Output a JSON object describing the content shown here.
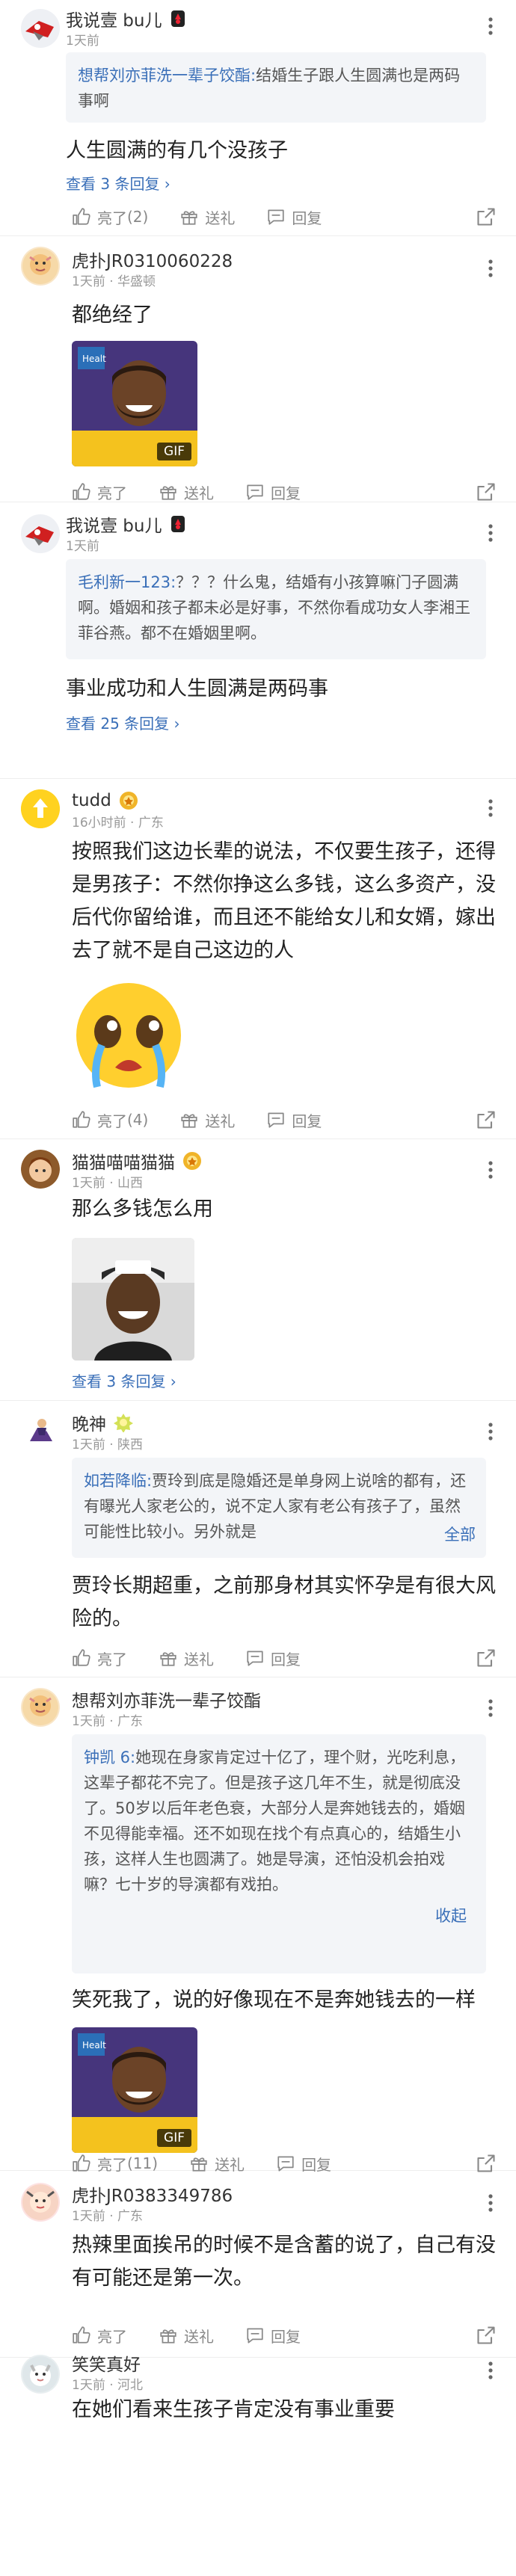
{
  "actions": {
    "like": "亮了",
    "gift": "送礼",
    "reply": "回复"
  },
  "comments": [
    {
      "username": "我说壹 bu儿",
      "meta": "1天前",
      "quote_author": "想帮刘亦菲洗一辈子饺酯:",
      "quote_text": "结婚生子跟人生圆满也是两码事啊",
      "text": "人生圆满的有几个没孩子",
      "replies": "查看 3 条回复",
      "likes": "(2)"
    },
    {
      "username": "虎扑JR0310060228",
      "meta": "1天前 · 华盛顿",
      "text": "都绝经了",
      "gif": "GIF"
    },
    {
      "username": "我说壹 bu儿",
      "meta": "1天前",
      "quote_author": "毛利新一123:",
      "quote_text": "？？？什么鬼，结婚有小孩算嘛门子圆满啊。婚姻和孩子都未必是好事，不然你看成功女人李湘王菲谷燕。都不在婚姻里啊。",
      "text": "事业成功和人生圆满是两码事",
      "replies": "查看 25 条回复"
    },
    {
      "username": "tudd",
      "meta": "16小时前 · 广东",
      "text": "按照我们这边长辈的说法，不仅要生孩子，还得是男孩子：不然你挣这么多钱，这么多资产，没后代你留给谁，而且还不能给女儿和女婿，嫁出去了就不是自己这边的人",
      "likes": "(4)"
    },
    {
      "username": "猫猫喵喵猫猫",
      "meta": "1天前 · 山西",
      "text": "那么多钱怎么用",
      "replies": "查看 3 条回复"
    },
    {
      "username": "晚神",
      "meta": "1天前 · 陕西",
      "quote_author": "如若降临:",
      "quote_text": "贾玲到底是隐婚还是单身网上说啥的都有，还有曝光人家老公的，说不定人家有老公有孩子了，虽然可能性比较小。另外就是",
      "quote_more": "全部",
      "text": "贾玲长期超重，之前那身材其实怀孕是有很大风险的。"
    },
    {
      "username": "想帮刘亦菲洗一辈子饺酯",
      "meta": "1天前 · 广东",
      "quote_author": "钟凯 6:",
      "quote_text": "她现在身家肯定过十亿了，理个财，光吃利息，这辈子都花不完了。但是孩子这几年不生，就是彻底没了。50岁以后年老色衰，大部分人是奔她钱去的，婚姻不见得能幸福。还不如现在找个有点真心的，结婚生小孩，这样人生也圆满了。她是导演，还怕没机会拍戏嘛？七十岁的导演都有戏拍。",
      "quote_collapse": "收起",
      "text": "笑死我了，说的好像现在不是奔她钱去的一样",
      "gif": "GIF",
      "likes": "(11)"
    },
    {
      "username": "虎扑JR0383349786",
      "meta": "1天前 · 广东",
      "text": "热辣里面挨吊的时候不是含蓄的说了，自己有没有可能还是第一次。"
    },
    {
      "username": "笑笑真好",
      "meta": "1天前 · 河北",
      "text": "在她们看来生孩子肯定没有事业重要"
    }
  ]
}
